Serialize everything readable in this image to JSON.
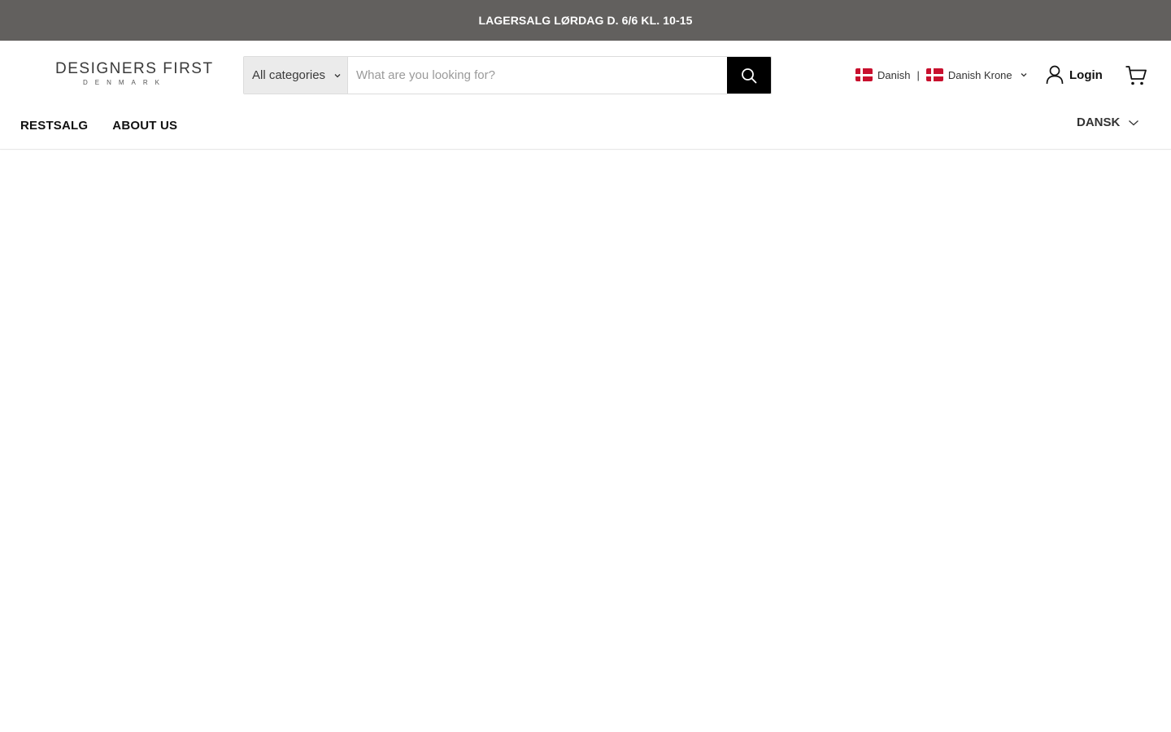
{
  "announcement": {
    "text": "LAGERSALG LØRDAG D. 6/6 KL. 10-15",
    "background": "#62605e"
  },
  "logo": {
    "main": "DESIGNERS FIRST",
    "sub": "DENMARK"
  },
  "search": {
    "category": "All categories",
    "placeholder": "What are you looking for?",
    "button_icon": "search-icon"
  },
  "locale": {
    "language": "Danish",
    "separator": "|",
    "currency": "Danish Krone"
  },
  "account": {
    "login_label": "Login"
  },
  "cart": {
    "icon": "cart-icon"
  },
  "nav": {
    "items": [
      {
        "label": "RESTSALG"
      },
      {
        "label": "ABOUT US"
      }
    ]
  },
  "language_selector": {
    "label": "DANSK"
  }
}
